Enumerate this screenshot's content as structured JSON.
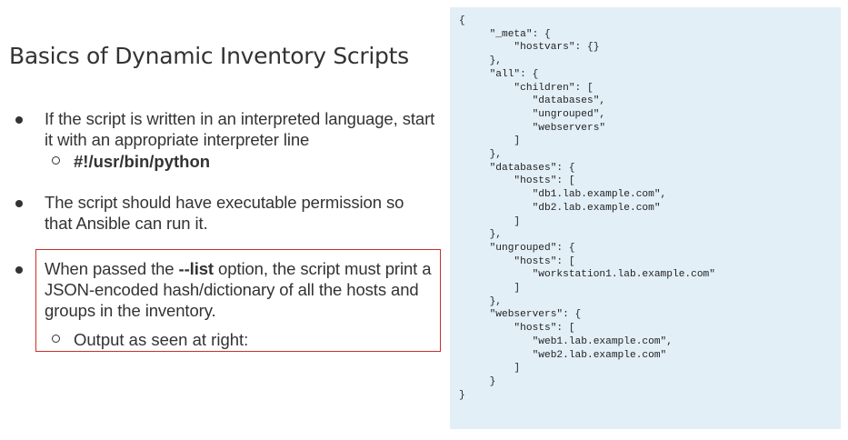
{
  "title": "Basics of Dynamic Inventory Scripts",
  "bullets": [
    {
      "text": "If the script is written in an interpreted language, start it with an appropriate interpreter line",
      "sub": "#!/usr/bin/python"
    },
    {
      "text": "The script should have executable permission so that Ansible can run it."
    },
    {
      "text_before": "When passed the ",
      "text_bold": "--list",
      "text_after": " option, the script must print a JSON-encoded hash/dictionary of all the hosts and groups in the inventory.",
      "sub": "Output as seen at right:"
    }
  ],
  "code": "{\n     \"_meta\": {\n         \"hostvars\": {}\n     },\n     \"all\": {\n         \"children\": [\n            \"databases\",\n            \"ungrouped\",\n            \"webservers\"\n         ]\n     },\n     \"databases\": {\n         \"hosts\": [\n            \"db1.lab.example.com\",\n            \"db2.lab.example.com\"\n         ]\n     },\n     \"ungrouped\": {\n         \"hosts\": [\n            \"workstation1.lab.example.com\"\n         ]\n     },\n     \"webservers\": {\n         \"hosts\": [\n            \"web1.lab.example.com\",\n            \"web2.lab.example.com\"\n         ]\n     }\n}",
  "colors": {
    "text": "#333333",
    "code_background": "#e3eff7",
    "highlight_border": "#c9302c"
  }
}
